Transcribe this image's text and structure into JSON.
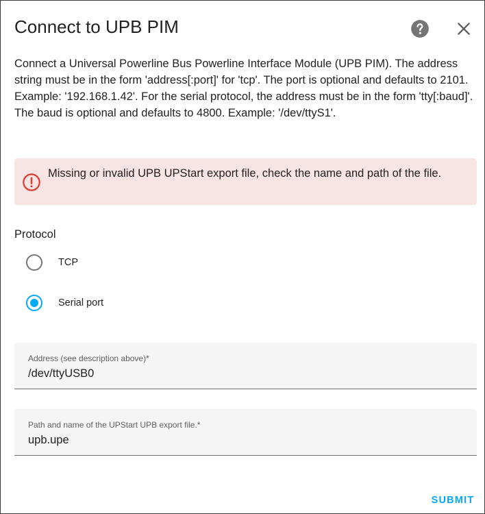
{
  "dialog": {
    "title": "Connect to UPB PIM",
    "description": "Connect a Universal Powerline Bus Powerline Interface Module (UPB PIM). The address string must be in the form 'address[:port]' for 'tcp'. The port is optional and defaults to 2101. Example: '192.168.1.42'. For the serial protocol, the address must be in the form 'tty[:baud]'. The baud is optional and defaults to 4800. Example: '/dev/ttyS1'.",
    "help_icon": "help-circle-icon",
    "close_icon": "close-icon"
  },
  "alert": {
    "icon": "alert-circle-outline-icon",
    "message": "Missing or invalid UPB UPStart export file, check the name and path of the file.",
    "color": "#db4437",
    "background": "#f8e4e2"
  },
  "protocol": {
    "label": "Protocol",
    "options": [
      {
        "label": "TCP",
        "selected": false
      },
      {
        "label": "Serial port",
        "selected": true
      }
    ]
  },
  "fields": {
    "address": {
      "label": "Address (see description above)*",
      "value": "/dev/ttyUSB0"
    },
    "file_path": {
      "label": "Path and name of the UPStart UPB export file.*",
      "value": "upb.upe"
    }
  },
  "actions": {
    "submit_label": "SUBMIT"
  },
  "colors": {
    "accent": "#03a9f4",
    "radio_unselected": "#757575",
    "help_icon": "#757575",
    "field_bg": "#f5f5f5"
  }
}
